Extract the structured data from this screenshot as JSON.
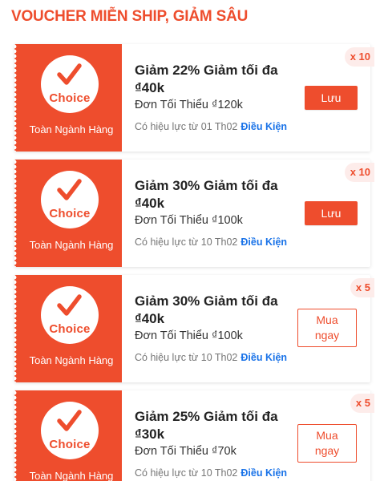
{
  "page": {
    "title": "VOUCHER MIỄN SHIP, GIẢM SÂU"
  },
  "colors": {
    "accent": "#ee4d2d",
    "link": "#1a73e8",
    "badge_bg": "#fdecea"
  },
  "vouchers": [
    {
      "badge_text": "Choice",
      "scope": "Toàn Ngành Hàng",
      "title": "Giảm 22% Giảm tối đa ₫40k",
      "min_order": "Đơn Tối Thiểu ₫120k",
      "validity": "Có hiệu lực từ 01 Th02",
      "terms_link": "Điều Kiện",
      "action_label": "Lưu",
      "action_type": "save",
      "quantity": "x 10"
    },
    {
      "badge_text": "Choice",
      "scope": "Toàn Ngành Hàng",
      "title": "Giảm 30% Giảm tối đa ₫40k",
      "min_order": "Đơn Tối Thiểu ₫100k",
      "validity": "Có hiệu lực từ 10 Th02",
      "terms_link": "Điều Kiện",
      "action_label": "Lưu",
      "action_type": "save",
      "quantity": "x 10"
    },
    {
      "badge_text": "Choice",
      "scope": "Toàn Ngành Hàng",
      "title": "Giảm 30% Giảm tối đa ₫40k",
      "min_order": "Đơn Tối Thiểu ₫100k",
      "validity": "Có hiệu lực từ 10 Th02",
      "terms_link": "Điều Kiện",
      "action_label": "Mua ngay",
      "action_type": "buy",
      "quantity": "x 5"
    },
    {
      "badge_text": "Choice",
      "scope": "Toàn Ngành Hàng",
      "title": "Giảm 25% Giảm tối đa ₫30k",
      "min_order": "Đơn Tối Thiểu ₫70k",
      "validity": "Có hiệu lực từ 10 Th02",
      "terms_link": "Điều Kiện",
      "action_label": "Mua ngay",
      "action_type": "buy",
      "quantity": "x 5"
    }
  ]
}
